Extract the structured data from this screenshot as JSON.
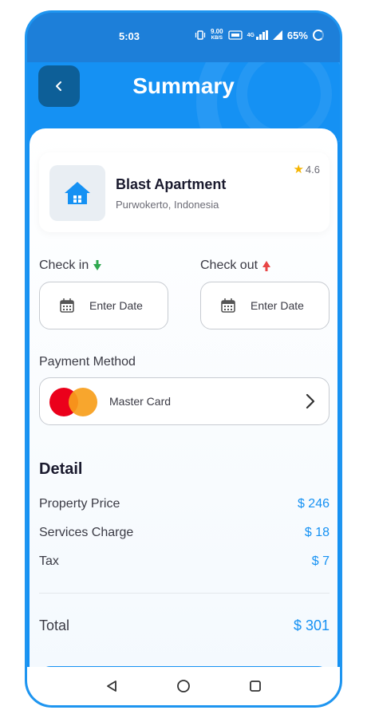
{
  "status_bar": {
    "time": "5:03",
    "speed_value": "9.00",
    "speed_unit": "KB/S",
    "network": "4G",
    "battery": "65%"
  },
  "header": {
    "title": "Summary",
    "back_icon": "chevron-left-icon"
  },
  "property": {
    "name": "Blast Apartment",
    "location": "Purwokerto, Indonesia",
    "rating": "4.6",
    "icon": "house-icon"
  },
  "check_in": {
    "label": "Check in",
    "placeholder": "Enter Date"
  },
  "check_out": {
    "label": "Check out",
    "placeholder": "Enter Date"
  },
  "payment": {
    "label": "Payment Method",
    "method": "Master Card"
  },
  "detail": {
    "title": "Detail",
    "rows": [
      {
        "label": "Property Price",
        "value": "$ 246"
      },
      {
        "label": "Services Charge",
        "value": "$ 18"
      },
      {
        "label": "Tax",
        "value": "$ 7"
      }
    ],
    "total_label": "Total",
    "total_value": "$ 301"
  },
  "colors": {
    "primary": "#1591f3",
    "dark_button": "#0d5f98",
    "check_in_arrow": "#2fa84f",
    "check_out_arrow": "#e84545",
    "mastercard_red": "#eb001b",
    "mastercard_orange": "#f79e1b"
  }
}
